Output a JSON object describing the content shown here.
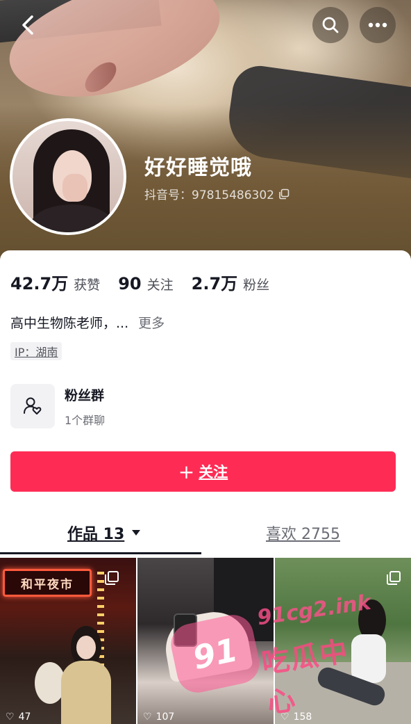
{
  "profile": {
    "nickname": "好好睡觉哦",
    "douyin_id": "抖音号：97815486302"
  },
  "stats": [
    {
      "num": "42.7万",
      "label": "获赞"
    },
    {
      "num": "90",
      "label": "关注"
    },
    {
      "num": "2.7万",
      "label": "粉丝"
    }
  ],
  "bio": {
    "text": "高中生物陈老师，...",
    "more": "更多"
  },
  "ip": "IP：湖南",
  "fan_group": {
    "title": "粉丝群",
    "subtitle": "1个群聊"
  },
  "follow_button": {
    "plus": "+",
    "label": "关注"
  },
  "tabs": {
    "works": "作品 13",
    "likes": "喜欢 2755"
  },
  "thumbnails": [
    {
      "sign_text": "和平夜市",
      "likes": "47"
    },
    {
      "likes": "107"
    },
    {
      "likes": "158"
    }
  ],
  "watermark": {
    "badge": "91",
    "domain": "91cg2.ink",
    "text": "吃瓜中心"
  },
  "colors": {
    "accent": "#fe2c55",
    "text_primary": "#161823",
    "text_secondary": "#6b6d75"
  },
  "icons": [
    "back-icon",
    "search-icon",
    "more-icon",
    "copy-icon",
    "fan-group-icon",
    "dropdown-triangle-icon",
    "multi-image-icon",
    "heart-icon"
  ]
}
